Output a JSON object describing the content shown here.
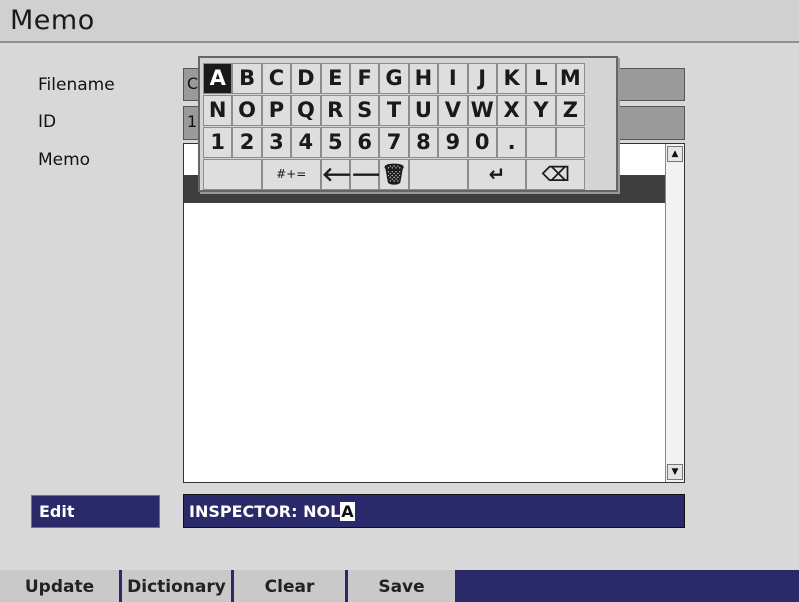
{
  "window": {
    "title": "Memo"
  },
  "fields": {
    "filename_label": "Filename",
    "filename_value": "C",
    "id_label": "ID",
    "id_value": "1",
    "memo_label": "Memo"
  },
  "edit": {
    "label": "Edit",
    "value": "INSPECTOR: NOL",
    "cursor_char": "A"
  },
  "scrollbar": {
    "up_icon": "▲",
    "down_icon": "▼"
  },
  "keyboard": {
    "selected_key": "A",
    "row1": [
      "A",
      "B",
      "C",
      "D",
      "E",
      "F",
      "G",
      "H",
      "I",
      "J",
      "K",
      "L",
      "M"
    ],
    "row2": [
      "N",
      "O",
      "P",
      "Q",
      "R",
      "S",
      "T",
      "U",
      "V",
      "W",
      "X",
      "Y",
      "Z"
    ],
    "row3": [
      "1",
      "2",
      "3",
      "4",
      "5",
      "6",
      "7",
      "8",
      "9",
      "0",
      ".",
      "",
      ""
    ],
    "row4": {
      "symbols_label": "#+=",
      "left_arrow": "🡐",
      "right_arrow": "🡒",
      "delete_icon": "🗑",
      "enter_icon": "↵",
      "backspace_icon": "⌫"
    }
  },
  "bottom_bar": {
    "update": "Update",
    "dictionary": "Dictionary",
    "clear": "Clear",
    "save": "Save"
  },
  "colors": {
    "accent_dark_blue": "#2a2a6a",
    "panel_gray": "#d8d8d8",
    "field_gray": "#9a9a9a"
  }
}
